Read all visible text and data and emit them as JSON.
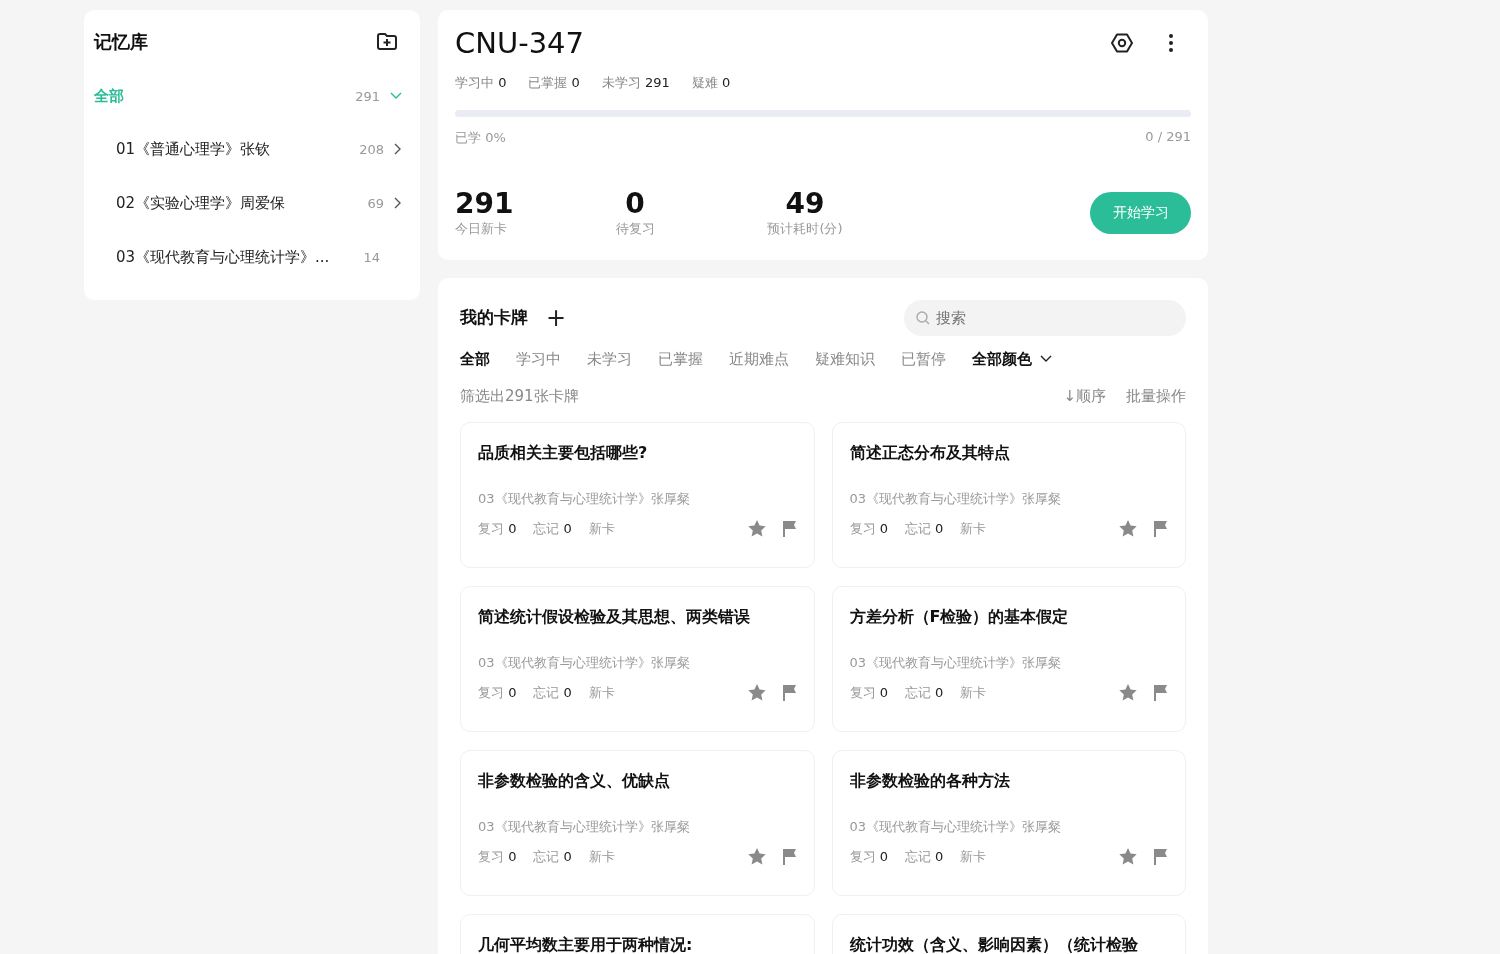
{
  "sidebar": {
    "title": "记忆库",
    "items": [
      {
        "label": "全部",
        "count": "291",
        "selected": true,
        "expanded": true
      },
      {
        "label": "01《普通心理学》张钦",
        "count": "208",
        "selected": false,
        "expanded": false
      },
      {
        "label": "02《实验心理学》周爱保",
        "count": "69",
        "selected": false,
        "expanded": false
      },
      {
        "label": "03《现代教育与心理统计学》...",
        "count": "14",
        "selected": false
      }
    ]
  },
  "deck": {
    "title": "CNU-347",
    "stats": [
      {
        "label": "学习中",
        "value": "0"
      },
      {
        "label": "已掌握",
        "value": "0"
      },
      {
        "label": "未学习",
        "value": "291"
      },
      {
        "label": "疑难",
        "value": "0"
      }
    ],
    "progress": {
      "level": 0,
      "label": "已学 0%",
      "reading": "0 / 291"
    },
    "summary": [
      {
        "value": "291",
        "label": "今日新卡"
      },
      {
        "value": "0",
        "label": "待复习"
      },
      {
        "value": "49",
        "label": "预计耗时(分)"
      }
    ],
    "start_button": "开始学习"
  },
  "cards_panel": {
    "title": "我的卡牌",
    "add": "+",
    "search": {
      "placeholder": "搜索"
    },
    "filters": [
      {
        "label": "全部",
        "selected": true
      },
      {
        "label": "学习中",
        "selected": false
      },
      {
        "label": "未学习",
        "selected": false
      },
      {
        "label": "已掌握",
        "selected": false
      },
      {
        "label": "近期难点",
        "selected": false
      },
      {
        "label": "疑难知识",
        "selected": false
      },
      {
        "label": "已暂停",
        "selected": false
      }
    ],
    "color_filter": "全部颜色",
    "count_text": "筛选出291张卡牌",
    "sort": "↓顺序",
    "batch": "批量操作",
    "cards": [
      {
        "title": "品质相关主要包括哪些?",
        "deck": "03《现代教育与心理统计学》张厚粲",
        "review_label": "复习",
        "review": "0",
        "forget_label": "忘记",
        "forget": "0",
        "status": "新卡"
      },
      {
        "title": "简述正态分布及其特点",
        "deck": "03《现代教育与心理统计学》张厚粲",
        "review_label": "复习",
        "review": "0",
        "forget_label": "忘记",
        "forget": "0",
        "status": "新卡"
      },
      {
        "title": "简述统计假设检验及其思想、两类错误",
        "deck": "03《现代教育与心理统计学》张厚粲",
        "review_label": "复习",
        "review": "0",
        "forget_label": "忘记",
        "forget": "0",
        "status": "新卡"
      },
      {
        "title": "方差分析（F检验）的基本假定",
        "deck": "03《现代教育与心理统计学》张厚粲",
        "review_label": "复习",
        "review": "0",
        "forget_label": "忘记",
        "forget": "0",
        "status": "新卡"
      },
      {
        "title": "非参数检验的含义、优缺点",
        "deck": "03《现代教育与心理统计学》张厚粲",
        "review_label": "复习",
        "review": "0",
        "forget_label": "忘记",
        "forget": "0",
        "status": "新卡"
      },
      {
        "title": "非参数检验的各种方法",
        "deck": "03《现代教育与心理统计学》张厚粲",
        "review_label": "复习",
        "review": "0",
        "forget_label": "忘记",
        "forget": "0",
        "status": "新卡"
      },
      {
        "title": "几何平均数主要用于两种情况:"
      },
      {
        "title": "统计功效（含义、影响因素）（统计检验"
      }
    ]
  }
}
